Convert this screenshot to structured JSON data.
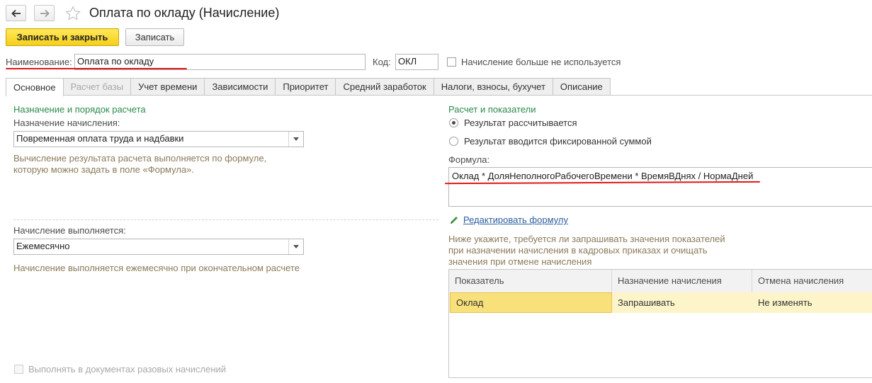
{
  "window": {
    "title": "Оплата по окладу (Начисление)",
    "back_icon": "arrow-left-icon",
    "forward_icon": "arrow-right-icon",
    "favorite_icon": "star-icon"
  },
  "toolbar": {
    "save_close_label": "Записать и закрыть",
    "save_label": "Записать"
  },
  "header": {
    "name_label": "Наименование:",
    "name_value": "Оплата по окладу",
    "code_label": "Код:",
    "code_value": "ОКЛ",
    "unused_label": "Начисление больше не используется",
    "unused_checked": false
  },
  "tabs": [
    {
      "label": "Основное",
      "active": true,
      "disabled": false
    },
    {
      "label": "Расчет базы",
      "active": false,
      "disabled": true
    },
    {
      "label": "Учет времени",
      "active": false,
      "disabled": false
    },
    {
      "label": "Зависимости",
      "active": false,
      "disabled": false
    },
    {
      "label": "Приоритет",
      "active": false,
      "disabled": false
    },
    {
      "label": "Средний заработок",
      "active": false,
      "disabled": false
    },
    {
      "label": "Налоги, взносы, бухучет",
      "active": false,
      "disabled": false
    },
    {
      "label": "Описание",
      "active": false,
      "disabled": false
    }
  ],
  "left": {
    "section_title": "Назначение и порядок расчета",
    "purpose_label": "Назначение начисления:",
    "purpose_value": "Повременная оплата труда и надбавки",
    "purpose_hint_1": "Вычисление результата расчета выполняется по формуле,",
    "purpose_hint_2": "которую можно задать в поле «Формула».",
    "performed_label": "Начисление выполняется:",
    "performed_value": "Ежемесячно",
    "performed_hint": "Начисление выполняется ежемесячно при окончательном расчете",
    "one_time_label": "Выполнять в документах разовых начислений"
  },
  "right": {
    "section_title": "Расчет и показатели",
    "radio_calculated": "Результат рассчитывается",
    "radio_fixed": "Результат вводится фиксированной суммой",
    "selected_radio": "calculated",
    "formula_label": "Формула:",
    "formula_value": "Оклад * ДоляНеполногоРабочегоВремени * ВремяВДнях / НормаДней",
    "edit_formula_link": "Редактировать формулу",
    "edit_icon": "pencil-icon",
    "indicators_hint_1": "Ниже укажите, требуется ли запрашивать значения показателей",
    "indicators_hint_2": "при назначении начисления в кадровых приказах и очищать",
    "indicators_hint_3": "значения при отмене начисления"
  },
  "table": {
    "columns": [
      "Показатель",
      "Назначение начисления",
      "Отмена начисления"
    ],
    "rows": [
      [
        "Оклад",
        "Запрашивать",
        "Не изменять"
      ]
    ]
  },
  "colors": {
    "accent_yellow": "#f5cf1b",
    "section_green": "#2a8a4a",
    "hint_brown": "#8a7a5a",
    "link_blue": "#2a5d9e",
    "annotation_red": "#e01818",
    "selected_row": "#fdf5c9"
  }
}
